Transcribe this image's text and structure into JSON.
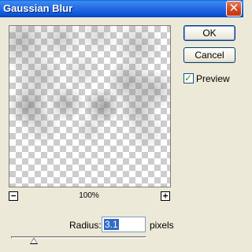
{
  "window": {
    "title": "Gaussian Blur",
    "close_symbol": "✕"
  },
  "preview": {
    "zoom_out_symbol": "−",
    "zoom_in_symbol": "+",
    "zoom_level": "100%"
  },
  "buttons": {
    "ok": "OK",
    "cancel": "Cancel"
  },
  "preview_toggle": {
    "label": "Preview",
    "checked": true,
    "check_symbol": "✓"
  },
  "radius": {
    "label": "Radius:",
    "value": "3.1",
    "unit": "pixels",
    "slider_value_fraction": 0.17
  },
  "colors": {
    "titlebar": "#0b55d6",
    "dialog_bg": "#ece9d8",
    "selection": "#316ac5",
    "close_button": "#d0471f"
  }
}
